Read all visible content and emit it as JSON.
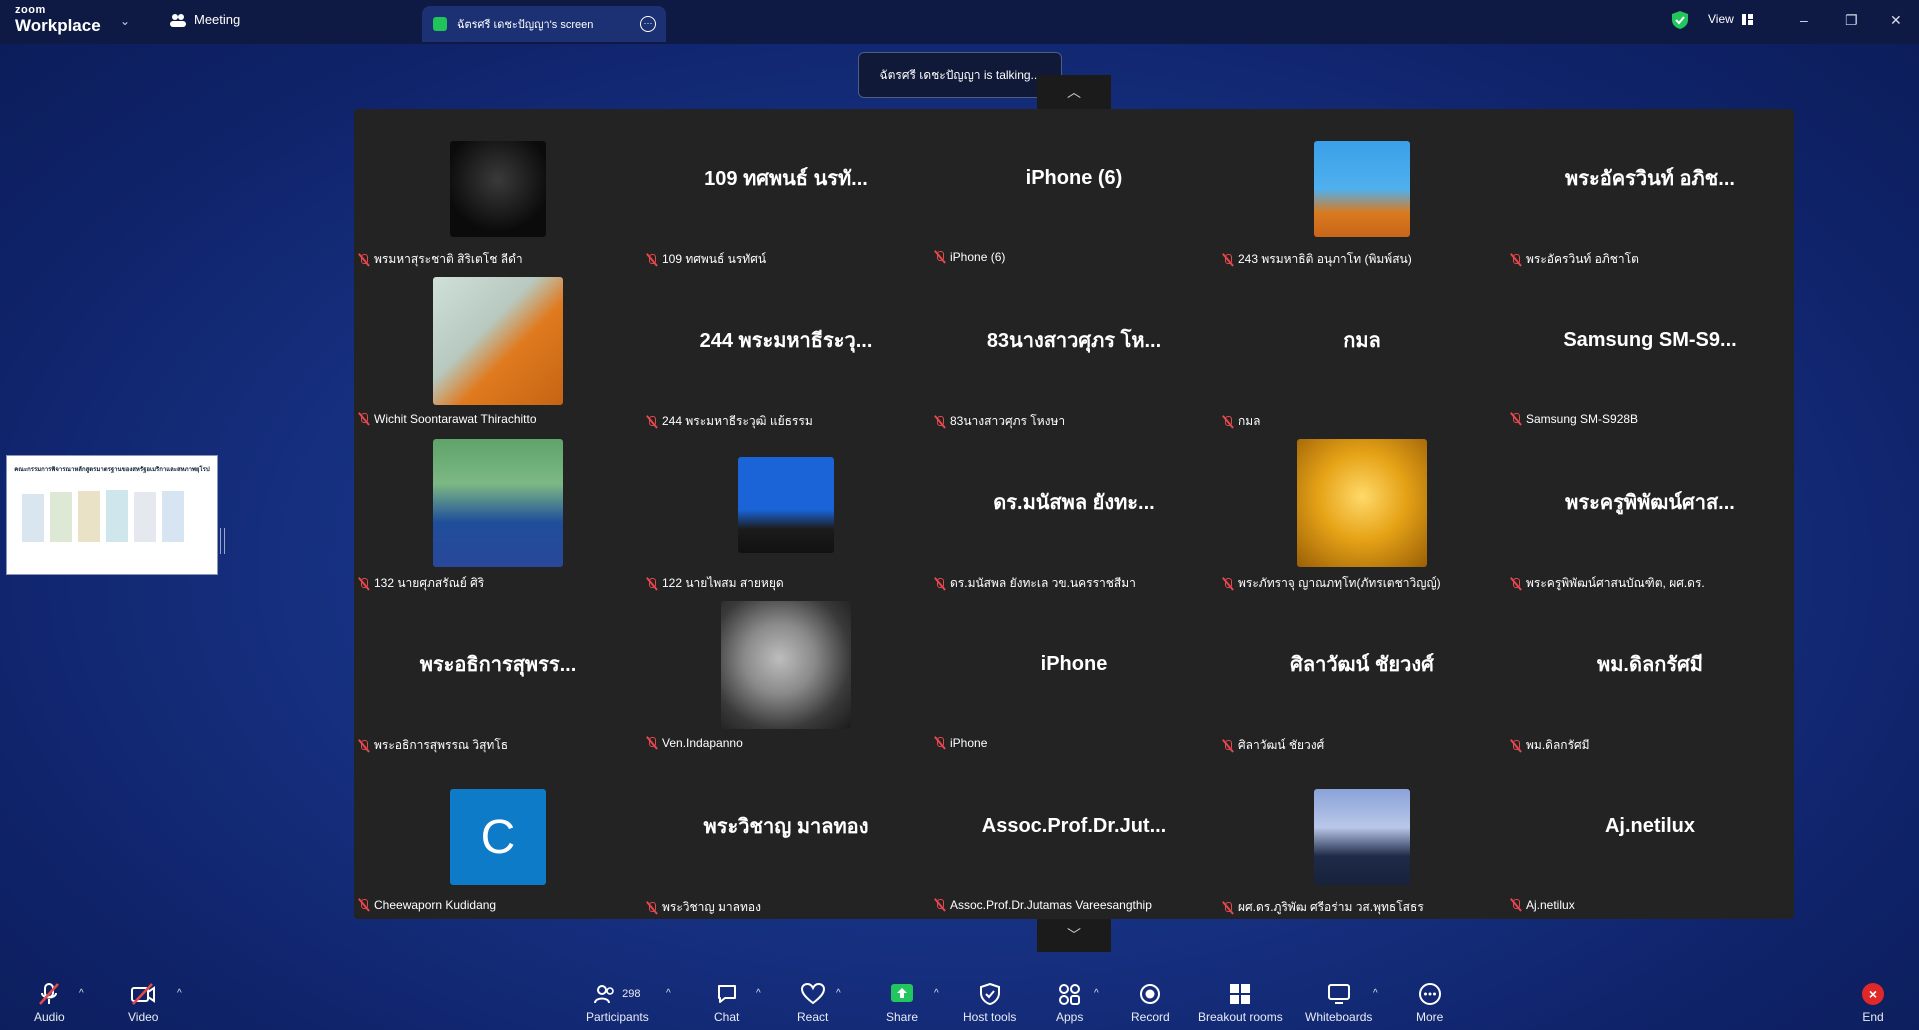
{
  "app": {
    "brand_top": "zoom",
    "brand_bottom": "Workplace"
  },
  "titlebar": {
    "meeting_label": "Meeting",
    "share_tab": "ฉัตรศรี เดชะปัญญา's screen",
    "view_label": "View",
    "minimize": "–",
    "restore": "❐",
    "close": "✕"
  },
  "toast": "ฉัตรศรี เดชะปัญญา is talking...",
  "nav": {
    "up": "︿",
    "down": "﹀"
  },
  "share_thumb": {
    "heading": "คณะกรรมการพิจารณาหลักสูตรมาตรฐานของสหรัฐอเมริกาและสหภาพยุโรป"
  },
  "tiles": [
    {
      "display": "",
      "name": "พรมหาสุระชาติ สิริเตโช ลีดำ"
    },
    {
      "display": "109 ทศพนธ์ นรทั...",
      "name": "109 ทศพนธ์ นรทัศน์"
    },
    {
      "display": "iPhone (6)",
      "name": "iPhone (6)"
    },
    {
      "display": "",
      "name": "243 พรมหาธิติ อนุภาโท (พิมพ์สน)"
    },
    {
      "display": "พระอัครวินท์ อภิช...",
      "name": "พระอัครวินท์ อภิชาโต"
    },
    {
      "display": "",
      "name": "Wichit Soontarawat Thirachitto"
    },
    {
      "display": "244 พระมหาธีระวุ...",
      "name": "244 พระมหาธีระวุฒิ แย้ธรรม"
    },
    {
      "display": "83นางสาวศุภร โห...",
      "name": "83นางสาวศุภร โหงษา"
    },
    {
      "display": "กมล",
      "name": "กมล"
    },
    {
      "display": "Samsung SM-S9...",
      "name": "Samsung SM-S928B"
    },
    {
      "display": "",
      "name": "132 นายศุภสรัณย์ ศิริ"
    },
    {
      "display": "",
      "name": "122 นายไพสม สายหยุด"
    },
    {
      "display": "ดร.มนัสพล ยังทะ...",
      "name": "ดร.มนัสพล ยังทะเล วข.นครราชสีมา"
    },
    {
      "display": "",
      "name": "พระภัทราจุ ญาณภทฺโท(ภัทรเตชาวิญญ์)"
    },
    {
      "display": "พระครูพิพัฒน์ศาส...",
      "name": "พระครูพิพัฒน์ศาสนบัณฑิต, ผศ.ดร."
    },
    {
      "display": "พระอธิการสุพรร...",
      "name": "พระอธิการสุพรรณ วิสุทโธ"
    },
    {
      "display": "",
      "name": "Ven.Indapanno"
    },
    {
      "display": "iPhone",
      "name": "iPhone"
    },
    {
      "display": "ศิลาวัฒน์ ชัยวงศ์",
      "name": "ศิลาวัฒน์ ชัยวงศ์"
    },
    {
      "display": "พม.ดิลกรัศมี",
      "name": "พม.ดิลกรัศมี"
    },
    {
      "display": "",
      "initial": "C",
      "name": "Cheewaporn Kudidang"
    },
    {
      "display": "พระวิชาญ มาลทอง",
      "name": "พระวิชาญ มาลทอง"
    },
    {
      "display": "Assoc.Prof.Dr.Jut...",
      "name": "Assoc.Prof.Dr.Jutamas Vareesangthip"
    },
    {
      "display": "",
      "name": "ผศ.ดร.ภูริพัฒ ศรีอร่าม วส.พุทธโสธร"
    },
    {
      "display": "Aj.netilux",
      "name": "Aj.netilux"
    }
  ],
  "toolbar": {
    "audio": "Audio",
    "video": "Video",
    "participants": "Participants",
    "participants_count": "298",
    "chat": "Chat",
    "react": "React",
    "share": "Share",
    "host_tools": "Host tools",
    "apps": "Apps",
    "record": "Record",
    "breakout": "Breakout rooms",
    "whiteboards": "Whiteboards",
    "more": "More",
    "end": "End"
  }
}
